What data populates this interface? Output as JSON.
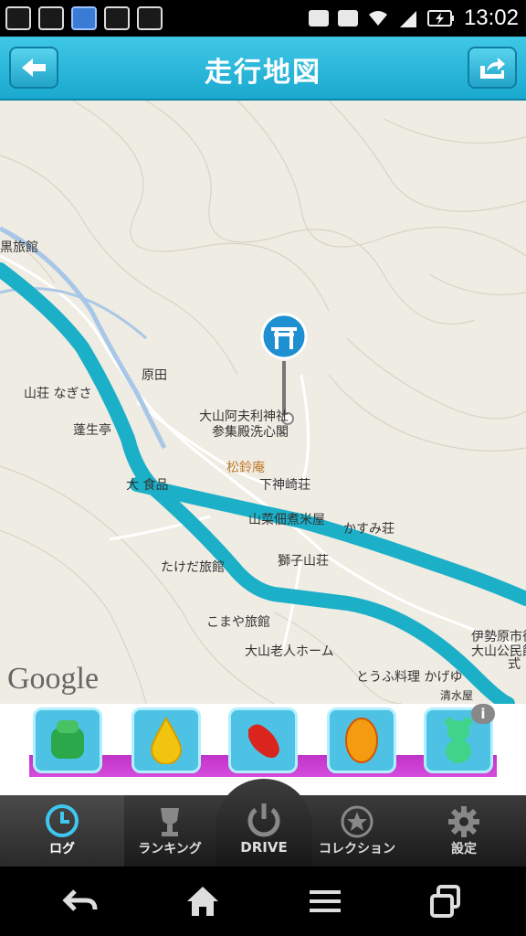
{
  "status_bar": {
    "time": "13:02",
    "left_icons": [
      "notification-74-icon",
      "image-icon",
      "app-icon",
      "no-sim-icon",
      "search-app-icon"
    ],
    "right_icons": [
      "cassette-icon",
      "heart-icon",
      "wifi-icon",
      "signal-icon",
      "battery-icon"
    ]
  },
  "header": {
    "title": "走行地図",
    "back_icon": "arrow-left-icon",
    "share_icon": "share-arrow-icon"
  },
  "map": {
    "attribution": "Google",
    "labels": {
      "kuro_ryokan": "黒旅館",
      "harada": "原田",
      "sanso_nagisa": "山荘 なぎさ",
      "hosei_tei": "蓬生亭 ",
      "shrine": "大山阿夫利神社",
      "shrine2": "参集殿洗心閣",
      "shorei_an": "松鈴庵",
      "shokuhin": "大       食品",
      "shimo_kanzaki": "下神崎荘",
      "yamagata": "山菜佃煮米屋",
      "kasumi": "かすみ荘",
      "takeda": "たけだ旅館",
      "shishiko": "獅子山荘",
      "komaya": "こまや旅館",
      "roujin": "大山老人ホーム",
      "tofu": "とうふ料理 かげゆ",
      "isehara1": "伊勢原市役",
      "isehara2": "大山公民館",
      "shiki": "式",
      "shimizu": "清水屋"
    }
  },
  "ad": {
    "items": [
      "green-candy-icon",
      "yellow-drop-icon",
      "red-jelly-icon",
      "orange-candy-icon",
      "gummy-bear-icon"
    ],
    "info_label": "i"
  },
  "tabs": {
    "log": "ログ",
    "ranking": "ランキング",
    "drive": "DRIVE",
    "collection": "コレクション",
    "settings": "設定"
  },
  "nav": [
    "back-icon",
    "home-icon",
    "menu-icon",
    "recent-apps-icon"
  ],
  "colors": {
    "header": "#1fb0d6",
    "route": "#1cb0c8",
    "map_bg": "#efece3",
    "tab_active_icon": "#3ec7ef"
  }
}
